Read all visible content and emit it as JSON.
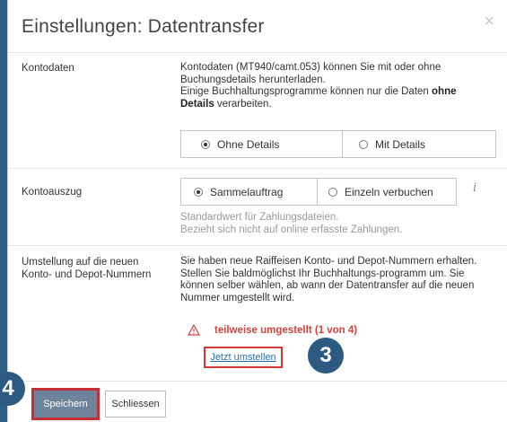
{
  "dialog": {
    "title": "Einstellungen: Datentransfer",
    "close_glyph": "×"
  },
  "kontodaten": {
    "label": "Kontodaten",
    "text_line1": "Kontodaten (MT940/camt.053) können Sie mit oder ohne",
    "text_line2": "Buchungsdetails herunterladen.",
    "text_line3_prefix": "Einige Buchhaltungsprogramme können nur die Daten ",
    "text_line3_bold": "ohne",
    "text_line4_bold": "Details",
    "text_line4_suffix": " verarbeiten.",
    "options": [
      {
        "label": "Ohne Details",
        "selected": true
      },
      {
        "label": "Mit Details",
        "selected": false
      }
    ]
  },
  "kontoauszug": {
    "label": "Kontoauszug",
    "options": [
      {
        "label": "Sammelauftrag",
        "selected": true
      },
      {
        "label": "Einzeln verbuchen",
        "selected": false
      }
    ],
    "info_glyph": "i",
    "hint_line1": "Standardwert für Zahlungsdateien.",
    "hint_line2": "Bezieht sich nicht auf online erfasste Zahlungen."
  },
  "umstellung": {
    "label_line1": "Umstellung auf die neuen",
    "label_line2": "Konto- und Depot-Nummern",
    "text_line1": "Sie haben neue Raiffeisen Konto- und Depot-Nummern erhalten.",
    "text_line2": "Stellen Sie baldmöglichst Ihr Buchhaltungs-programm um. Sie",
    "text_line3": "können selber wählen, ab wann der Datentransfer auf die neuen",
    "text_line4": "Nummer umgestellt wird.",
    "status_text": "teilweise umgestellt (1 von 4)",
    "action_label": "Jetzt umstellen"
  },
  "footer": {
    "save_label": "Speichern",
    "close_label": "Schliessen"
  },
  "annotations": {
    "step3": "3",
    "step4": "4"
  },
  "colors": {
    "accent_border": "#d23a3a",
    "warning": "#d0453f",
    "link": "#2c6ea6",
    "badge": "#2c5a80",
    "save_button": "#6d849b"
  }
}
